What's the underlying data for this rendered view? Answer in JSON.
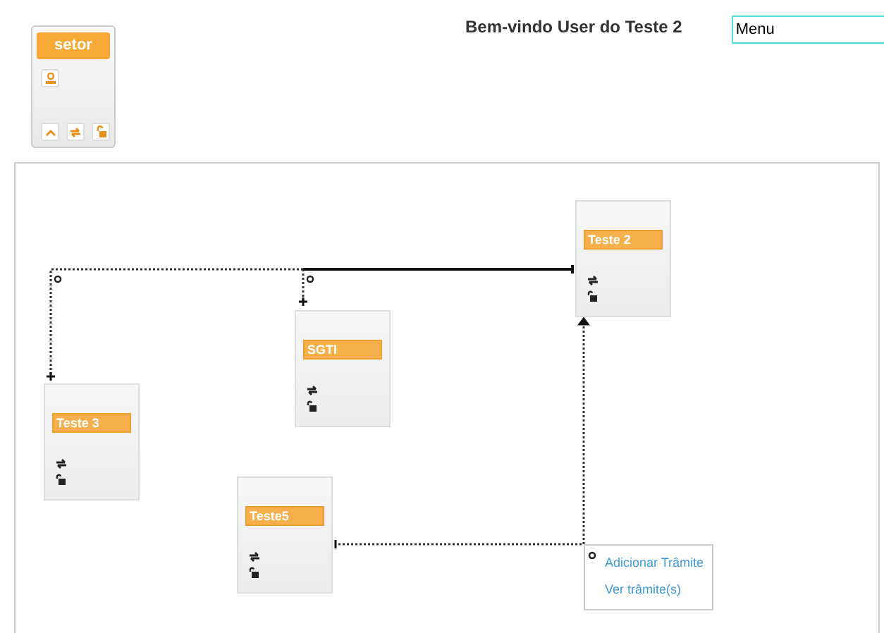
{
  "header": {
    "welcome": "Bem-vindo User do Teste 2",
    "menu_field": {
      "value": "Menu"
    }
  },
  "palette": {
    "title": "setor"
  },
  "nodes": [
    {
      "name": "Teste 2"
    },
    {
      "name": "SGTI"
    },
    {
      "name": "Teste 3"
    },
    {
      "name": "Teste5"
    }
  ],
  "context_menu": {
    "items": [
      "Adicionar Trâmite",
      "Ver trâmite(s)"
    ]
  }
}
